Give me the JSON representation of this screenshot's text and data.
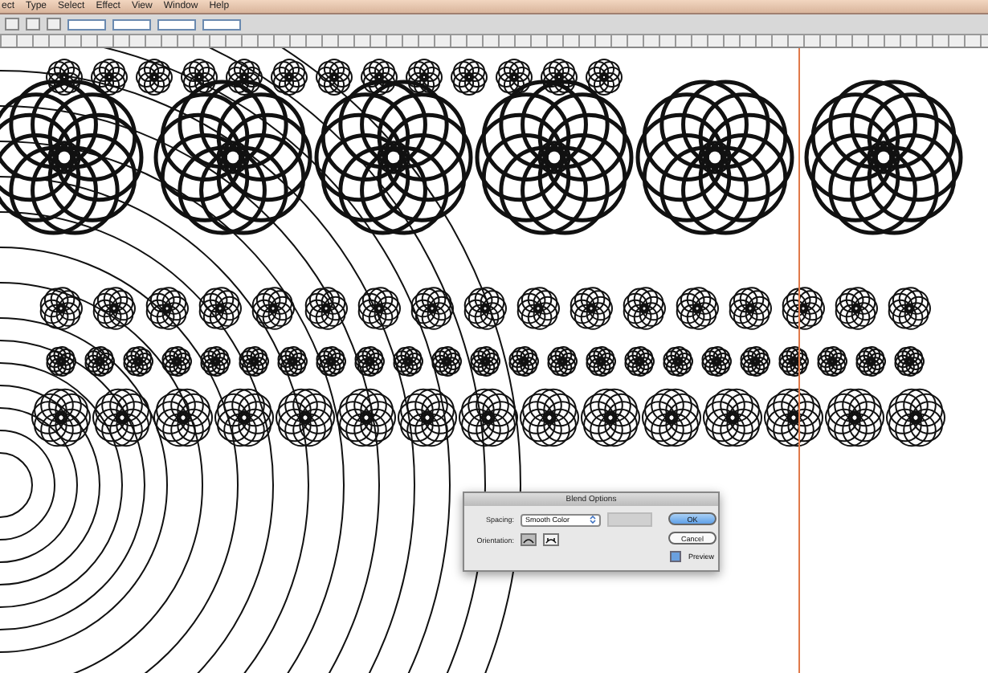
{
  "menu": [
    "ect",
    "Type",
    "Select",
    "Effect",
    "View",
    "Window",
    "Help"
  ],
  "dialog": {
    "title": "Blend Options",
    "spacing_label": "Spacing:",
    "spacing_value": "Smooth Color",
    "orientation_label": "Orientation:",
    "orientations": [
      {
        "kind": "page",
        "selected": true
      },
      {
        "kind": "path",
        "selected": false
      }
    ],
    "buttons": [
      {
        "label": "OK",
        "default": true
      },
      {
        "label": "Cancel",
        "default": false
      }
    ],
    "preview": {
      "label": "Preview",
      "checked": true
    }
  }
}
